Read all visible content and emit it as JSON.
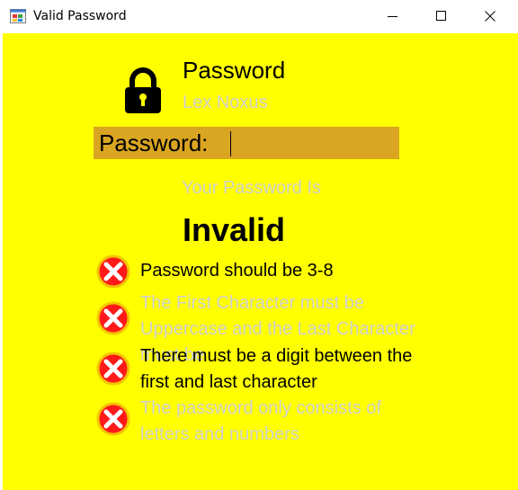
{
  "window": {
    "title": "Valid Password",
    "controls": {
      "minimize_icon": "minimize-icon",
      "maximize_icon": "maximize-icon",
      "close_icon": "close-icon"
    }
  },
  "header": {
    "title": "Password",
    "subtitle": "Lex Noxus",
    "icon": "lock-icon"
  },
  "password_field": {
    "label": "Password:",
    "value": ""
  },
  "result": {
    "label": "Your Password Is",
    "value": "Invalid"
  },
  "rules": [
    {
      "text": "Password should be 3-8",
      "status": "failed",
      "active": true,
      "icon": "x-circle-icon"
    },
    {
      "text": "The First Character must be Uppercase and the Last Character must be",
      "status": "failed",
      "active": false,
      "icon": "x-circle-icon"
    },
    {
      "text": "There must be a digit between the first and last character",
      "status": "failed",
      "active": true,
      "icon": "x-circle-icon"
    },
    {
      "text": "The password only consists of letters and numbers",
      "status": "failed",
      "active": false,
      "icon": "x-circle-icon"
    }
  ],
  "colors": {
    "background": "#ffff00",
    "field_background": "#daa520",
    "muted_text": "#d0d0d0",
    "error_icon_fill": "#ff1a1a",
    "error_icon_ring": "#f5c400"
  }
}
